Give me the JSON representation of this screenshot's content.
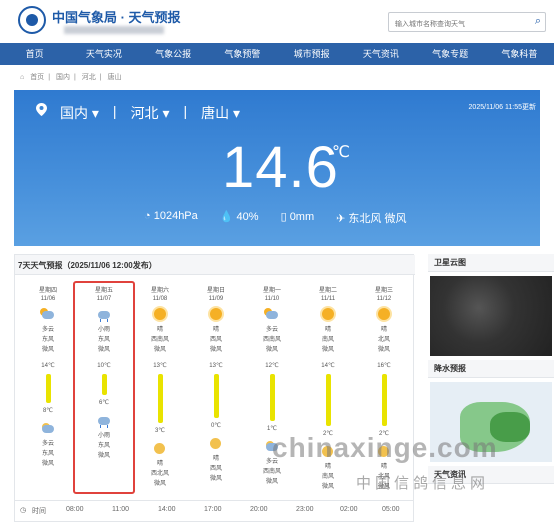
{
  "header": {
    "brand": "中国气象局 · 天气预报",
    "search_placeholder": "输入城市名称查询天气",
    "search_icon": "search-icon"
  },
  "nav": {
    "items": [
      "首页",
      "天气实况",
      "气象公报",
      "气象预警",
      "城市预报",
      "天气资讯",
      "气象专题",
      "气象科普"
    ]
  },
  "breadcrumb": [
    "首页",
    "国内",
    "河北",
    "唐山"
  ],
  "current": {
    "country": "国内",
    "province": "河北",
    "city": "唐山",
    "updated": "2025/11/06 11:55更新",
    "temperature": "14.6",
    "unit": "℃",
    "pressure": "1024hPa",
    "humidity": "40%",
    "precip": "0mm",
    "wind": "东北风 微风"
  },
  "forecast": {
    "title": "7天天气预报（2025/11/06 12:00发布）",
    "days": [
      {
        "week": "星期四",
        "date": "11/06",
        "day_icon": "partly-cloudy-icon",
        "day_weather": "多云",
        "day_wind_dir": "东风",
        "day_wind": "微风",
        "high": "14℃",
        "low": "8℃",
        "night_icon": "partly-cloudy-night-icon",
        "night_weather": "多云",
        "night_wind_dir": "东风",
        "night_wind": "微风",
        "bar_fraction": 0.55
      },
      {
        "week": "星期五",
        "date": "11/07",
        "day_icon": "light-rain-icon",
        "day_weather": "小雨",
        "day_wind_dir": "东风",
        "day_wind": "微风",
        "high": "10℃",
        "low": "6℃",
        "night_icon": "light-rain-icon",
        "night_weather": "小雨",
        "night_wind_dir": "东风",
        "night_wind": "微风",
        "bar_fraction": 0.4
      },
      {
        "week": "星期六",
        "date": "11/08",
        "day_icon": "sunny-icon",
        "day_weather": "晴",
        "day_wind_dir": "西南风",
        "day_wind": "微风",
        "high": "13℃",
        "low": "3℃",
        "night_icon": "clear-night-icon",
        "night_weather": "晴",
        "night_wind_dir": "西北风",
        "night_wind": "微风",
        "bar_fraction": 0.95
      },
      {
        "week": "星期日",
        "date": "11/09",
        "day_icon": "sunny-icon",
        "day_weather": "晴",
        "day_wind_dir": "西风",
        "day_wind": "微风",
        "high": "13℃",
        "low": "0℃",
        "night_icon": "clear-night-icon",
        "night_weather": "晴",
        "night_wind_dir": "西风",
        "night_wind": "微风",
        "bar_fraction": 0.85
      },
      {
        "week": "星期一",
        "date": "11/10",
        "day_icon": "partly-cloudy-icon",
        "day_weather": "多云",
        "day_wind_dir": "西南风",
        "day_wind": "微风",
        "high": "12℃",
        "low": "1℃",
        "night_icon": "partly-cloudy-night-icon",
        "night_weather": "多云",
        "night_wind_dir": "西南风",
        "night_wind": "微风",
        "bar_fraction": 0.9
      },
      {
        "week": "星期二",
        "date": "11/11",
        "day_icon": "sunny-icon",
        "day_weather": "晴",
        "day_wind_dir": "南风",
        "day_wind": "微风",
        "high": "14℃",
        "low": "2℃",
        "night_icon": "clear-night-icon",
        "night_weather": "晴",
        "night_wind_dir": "南风",
        "night_wind": "微风",
        "bar_fraction": 1.0
      },
      {
        "week": "星期三",
        "date": "11/12",
        "day_icon": "sunny-icon",
        "day_weather": "晴",
        "day_wind_dir": "北风",
        "day_wind": "微风",
        "high": "16℃",
        "low": "2℃",
        "night_icon": "clear-night-icon",
        "night_weather": "晴",
        "night_wind_dir": "北风",
        "night_wind": "微风",
        "bar_fraction": 1.0
      }
    ]
  },
  "timebar": {
    "label": "时间",
    "times": [
      "08:00",
      "11:00",
      "14:00",
      "17:00",
      "20:00",
      "23:00",
      "02:00",
      "05:00"
    ]
  },
  "side": {
    "satellite_title": "卫星云图",
    "rain_title": "降水预报",
    "news_title": "天气资讯"
  },
  "watermark": {
    "main": "chinaxinge.com",
    "sub": "中国信鸽信息网"
  },
  "colors": {
    "nav_bg": "#2c62a8",
    "brand": "#1e5aa8",
    "hero_top": "#2f7ad0",
    "temp_bar": "#e9e300",
    "highlight": "#e0423c"
  }
}
